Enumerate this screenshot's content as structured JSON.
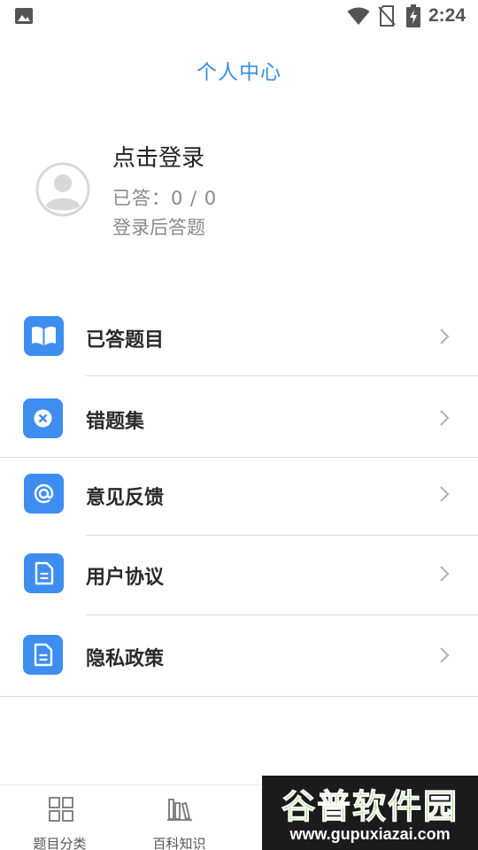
{
  "status_bar": {
    "time": "2:24",
    "icons": [
      "gallery-icon",
      "wifi-icon",
      "no-sim-icon",
      "battery-charging-icon"
    ]
  },
  "header": {
    "title": "个人中心"
  },
  "profile": {
    "login_label": "点击登录",
    "answered_label": "已答：0 / 0",
    "hint": "登录后答题",
    "avatar_icon": "user-avatar-icon"
  },
  "menu": {
    "items": [
      {
        "label": "已答题目",
        "icon": "open-book-icon"
      },
      {
        "label": "错题集",
        "icon": "close-circle-icon"
      },
      {
        "label": "意见反馈",
        "icon": "at-sign-icon"
      },
      {
        "label": "用户协议",
        "icon": "document-icon"
      },
      {
        "label": "隐私政策",
        "icon": "document-icon"
      }
    ],
    "chevron_icon": "chevron-right-icon"
  },
  "tab_bar": {
    "tabs": [
      {
        "label": "题目分类",
        "icon": "grid-icon"
      },
      {
        "label": "百科知识",
        "icon": "library-icon"
      },
      {
        "label": "",
        "icon": ""
      },
      {
        "label": "",
        "icon": ""
      }
    ]
  },
  "watermark": {
    "title": "谷普软件园",
    "url": "www.gupuxiazai.com"
  },
  "colors": {
    "accent": "#3d8ef0",
    "title": "#3a8ee6",
    "secondary_text": "#8a8a8a",
    "divider": "#dcdcdc"
  }
}
